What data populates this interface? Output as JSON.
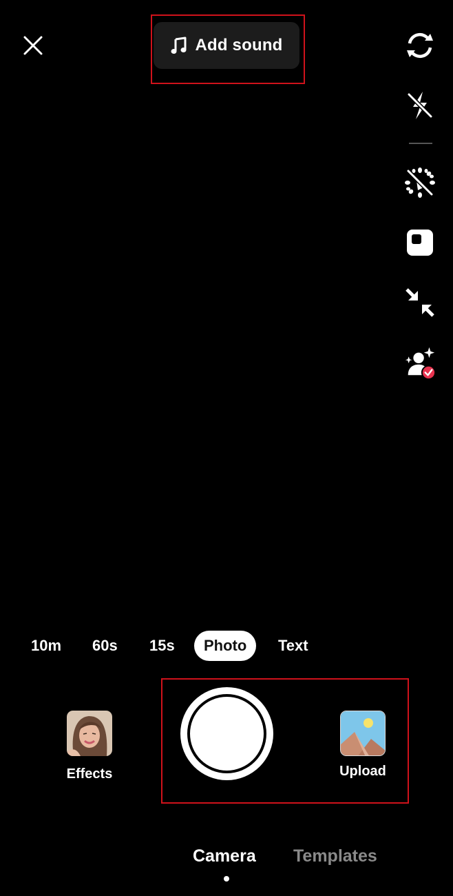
{
  "top_bar": {
    "close_icon": "close-icon",
    "add_sound": {
      "icon": "music-note-icon",
      "label": "Add sound"
    }
  },
  "side_rail": [
    {
      "icon": "flip-camera-icon",
      "label": "Flip"
    },
    {
      "icon": "flash-off-icon",
      "label": "Flash"
    },
    {
      "icon": "beauty-off-icon",
      "label": "Enhance"
    },
    {
      "icon": "filters-icon",
      "label": "Filters"
    },
    {
      "icon": "collapse-icon",
      "label": "Collapse"
    },
    {
      "icon": "retouch-user-icon",
      "label": "Retouch",
      "badge_color": "#e8334f"
    }
  ],
  "modes": {
    "items": [
      "10m",
      "60s",
      "15s",
      "Photo",
      "Text"
    ],
    "selected": "Photo"
  },
  "capture_row": {
    "effects_label": "Effects",
    "upload_label": "Upload",
    "shutter": "capture-button"
  },
  "bottom_tabs": {
    "items": [
      "Camera",
      "Templates"
    ],
    "selected": "Camera"
  },
  "colors": {
    "annotation": "#d0121b",
    "inactive_tab": "#8a8a8a",
    "badge": "#e8334f"
  }
}
